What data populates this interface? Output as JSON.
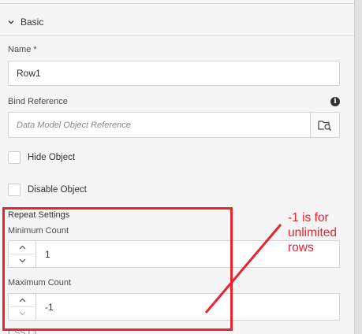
{
  "section": {
    "title": "Basic"
  },
  "name": {
    "label": "Name *",
    "value": "Row1"
  },
  "bind_reference": {
    "label": "Bind Reference",
    "placeholder": "Data Model Object Reference"
  },
  "hide_object": {
    "label": "Hide Object"
  },
  "disable_object": {
    "label": "Disable Object"
  },
  "repeat_settings": {
    "title": "Repeat Settings",
    "minimum": {
      "label": "Minimum Count",
      "value": "1"
    },
    "maximum": {
      "label": "Maximum Count",
      "value": "-1"
    }
  },
  "cut_label": "CSS Cl",
  "annotation": {
    "lines": [
      "-1 is for",
      "unlimited",
      "rows"
    ],
    "color": "#e8242f"
  }
}
